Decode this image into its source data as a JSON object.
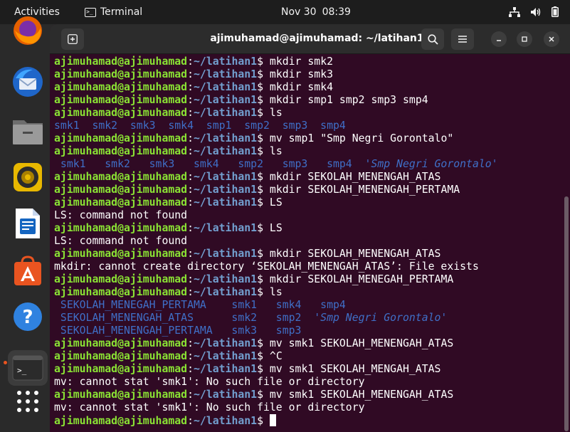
{
  "topbar": {
    "activities": "Activities",
    "app_name": "Terminal",
    "date": "Nov 30",
    "time": "08:39"
  },
  "dock": {
    "items": [
      "firefox",
      "thunderbird",
      "files",
      "rhythmbox",
      "libreoffice-writer",
      "ubuntu-software",
      "help",
      "terminal",
      "show-apps"
    ]
  },
  "window": {
    "title": "ajimuhamad@ajimuhamad: ~/latihan1"
  },
  "terminal": {
    "user_host": "ajimuhamad@ajimuhamad",
    "path": "~/latihan1",
    "lines": [
      {
        "type": "cmd",
        "text": "mkdir smk2"
      },
      {
        "type": "cmd",
        "text": "mkdir smk3"
      },
      {
        "type": "cmd",
        "text": "mkdir smk4"
      },
      {
        "type": "cmd",
        "text": "mkdir smp1 smp2 smp3 smp4"
      },
      {
        "type": "cmd",
        "text": "ls"
      },
      {
        "type": "ls",
        "text": "smk1  smk2  smk3  smk4  smp1  smp2  smp3  smp4"
      },
      {
        "type": "cmd",
        "text": "mv smp1 \"Smp Negri Gorontalo\""
      },
      {
        "type": "cmd",
        "text": "ls"
      },
      {
        "type": "ls2",
        "text": " smk1   smk2   smk3   smk4   smp2   smp3   smp4  ",
        "quoted": "'Smp Negri Gorontalo'"
      },
      {
        "type": "cmd",
        "text": "mkdir SEKOLAH_MENENGAH_ATAS"
      },
      {
        "type": "cmd",
        "text": "mkdir SEKOLAH_MENENGAH_PERTAMA"
      },
      {
        "type": "cmd",
        "text": "LS"
      },
      {
        "type": "out",
        "text": "LS: command not found"
      },
      {
        "type": "cmd",
        "text": "LS"
      },
      {
        "type": "out",
        "text": "LS: command not found"
      },
      {
        "type": "cmd",
        "text": "mkdir SEKOLAH_MENENGAH_ATAS"
      },
      {
        "type": "out",
        "text": "mkdir: cannot create directory ‘SEKOLAH_MENENGAH_ATAS’: File exists"
      },
      {
        "type": "cmd",
        "text": "mkdir SEKOLAH_MENEGAH_PERTAMA"
      },
      {
        "type": "cmd",
        "text": "ls"
      },
      {
        "type": "ls",
        "text": " SEKOLAH_MENEGAH_PERTAMA    smk1   smk4   smp4"
      },
      {
        "type": "ls2",
        "text": " SEKOLAH_MENENGAH_ATAS      smk2   smp2  ",
        "quoted": "'Smp Negri Gorontalo'"
      },
      {
        "type": "ls",
        "text": " SEKOLAH_MENENGAH_PERTAMA   smk3   smp3"
      },
      {
        "type": "cmd",
        "text": "mv smk1 SEKOLAH_MENENGAH_ATAS"
      },
      {
        "type": "cmd",
        "text": "^C"
      },
      {
        "type": "cmd",
        "text": "mv smk1 SEKOLAH_MENGAH_ATAS"
      },
      {
        "type": "out",
        "text": "mv: cannot stat 'smk1': No such file or directory"
      },
      {
        "type": "cmd",
        "text": "mv smk1 SEKOLAH_MENENGAH_ATAS"
      },
      {
        "type": "out",
        "text": "mv: cannot stat 'smk1': No such file or directory"
      },
      {
        "type": "prompt",
        "text": ""
      }
    ]
  },
  "colors": {
    "terminal_bg": "#300a24",
    "user_host": "#8ae234",
    "path": "#729fcf",
    "dir_listing": "#3f6fc7",
    "accent": "#e95420"
  }
}
